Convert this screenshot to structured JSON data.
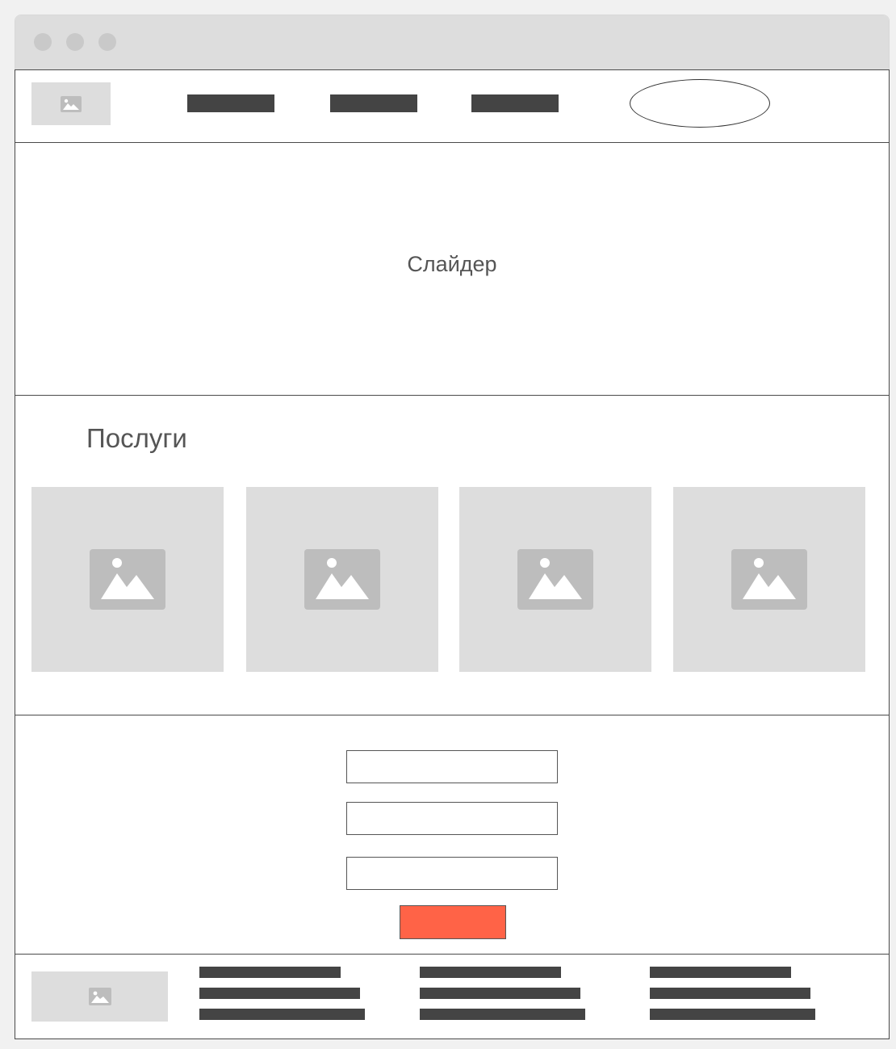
{
  "slider": {
    "label": "Слайдер"
  },
  "services": {
    "title": "Послуги",
    "cards": [
      {
        "icon": "image-icon"
      },
      {
        "icon": "image-icon"
      },
      {
        "icon": "image-icon"
      },
      {
        "icon": "image-icon"
      }
    ]
  },
  "form": {
    "fields": 3,
    "submit_color": "#ff6347"
  },
  "colors": {
    "placeholder": "#dddddd",
    "placeholder_icon": "#bdbdbd",
    "text_bar": "#444444",
    "border": "#4a4a4a"
  }
}
